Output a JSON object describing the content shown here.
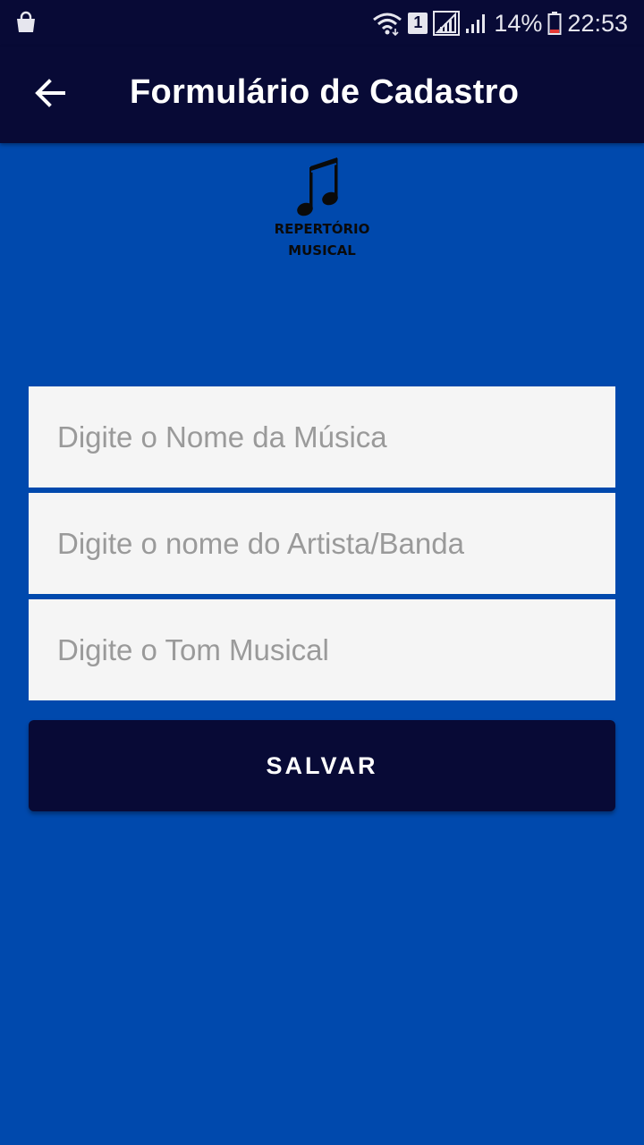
{
  "status_bar": {
    "battery_percent": "14%",
    "time": "22:53",
    "sim_slot": "1",
    "icons": [
      "shopping-bag-icon",
      "wifi-icon",
      "sim-icon",
      "signal-icon",
      "signal-icon",
      "battery-icon"
    ]
  },
  "app_bar": {
    "title": "Formulário de Cadastro",
    "back_icon": "arrow-back-icon"
  },
  "logo": {
    "icon": "music-note-icon",
    "line1": "REPERTÓRIO",
    "line2": "MUSICAL"
  },
  "form": {
    "song_placeholder": "Digite o Nome da Música",
    "artist_placeholder": "Digite o nome do Artista/Banda",
    "key_placeholder": "Digite o Tom Musical",
    "save_label": "SALVAR"
  },
  "colors": {
    "background": "#0049AD",
    "app_bar": "#080A36",
    "button": "#080A36",
    "field": "#F5F5F5"
  }
}
